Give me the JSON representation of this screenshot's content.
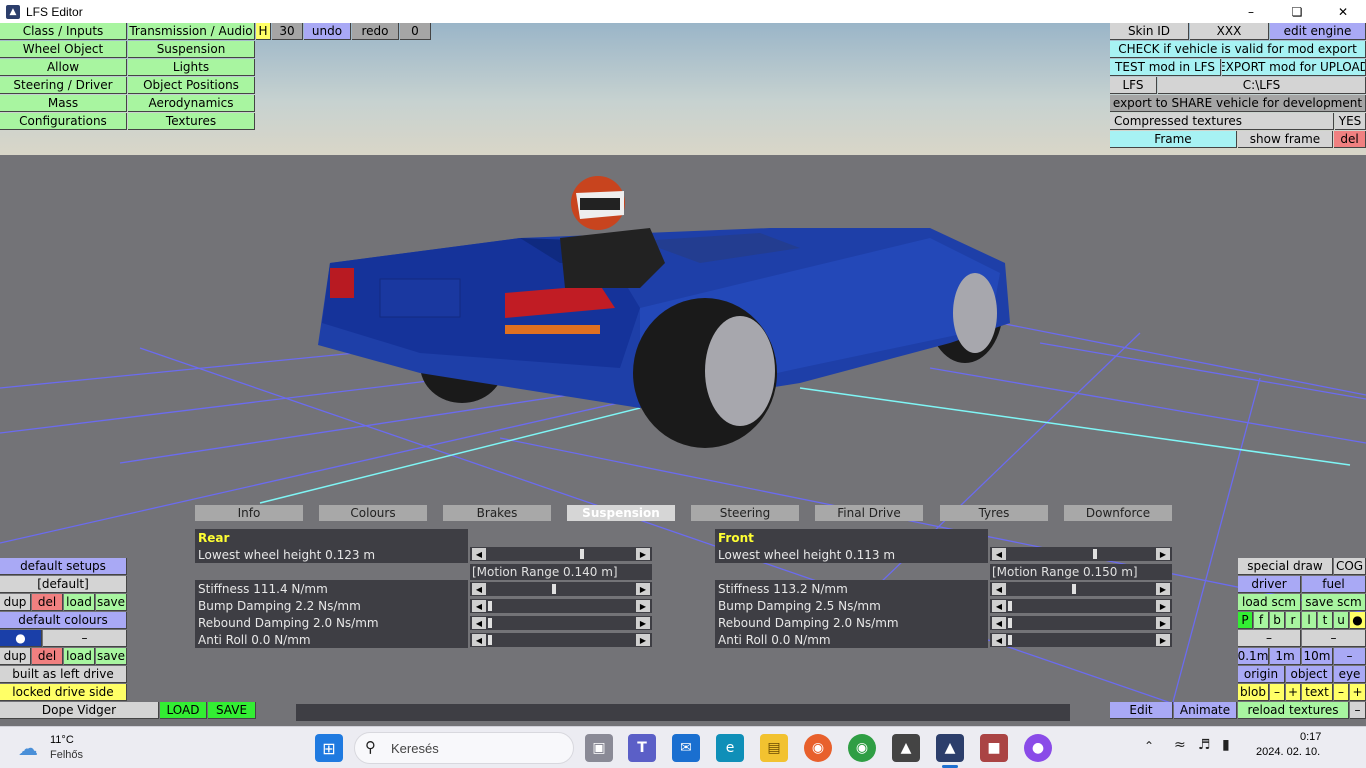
{
  "window": {
    "title": "LFS Editor",
    "minimize": "–",
    "maximize": "❏",
    "close": "✕"
  },
  "left_menu": {
    "class_inputs": "Class / Inputs",
    "transmission_audio": "Transmission / Audio",
    "wheel_object": "Wheel Object",
    "suspension": "Suspension",
    "allow": "Allow",
    "lights": "Lights",
    "steering_driver": "Steering / Driver",
    "object_positions": "Object Positions",
    "mass": "Mass",
    "aerodynamics": "Aerodynamics",
    "configurations": "Configurations",
    "textures": "Textures"
  },
  "toolbar": {
    "h": "H",
    "value_30": "30",
    "undo": "undo",
    "redo": "redo",
    "zero": "0"
  },
  "right_top": {
    "skin_id": "Skin ID",
    "skin_value": "XXX",
    "edit_engine": "edit engine",
    "check_valid": "CHECK if vehicle is valid for mod export",
    "test_mod": "TEST mod in LFS",
    "export_mod": "EXPORT mod for UPLOAD",
    "lfs": "LFS",
    "lfs_path": "C:\\LFS",
    "export_share": "export to SHARE vehicle for development",
    "compressed_textures": "Compressed textures",
    "compressed_value": "YES",
    "frame": "Frame",
    "show_frame": "show frame",
    "del": "del"
  },
  "tabs": [
    "Info",
    "Colours",
    "Brakes",
    "Suspension",
    "Steering",
    "Final Drive",
    "Tyres",
    "Downforce"
  ],
  "active_tab": "Suspension",
  "rear": {
    "header": "Rear",
    "lowest_wheel_height": "Lowest wheel height 0.123 m",
    "motion_range": "[Motion Range 0.140 m]",
    "stiffness": "Stiffness 111.4 N/mm",
    "bump_damping": "Bump Damping 2.2 Ns/mm",
    "rebound_damping": "Rebound Damping 2.0 Ns/mm",
    "anti_roll": "Anti Roll 0.0 N/mm"
  },
  "front": {
    "header": "Front",
    "lowest_wheel_height": "Lowest wheel height 0.113 m",
    "motion_range": "[Motion Range 0.150 m]",
    "stiffness": "Stiffness 113.2 N/mm",
    "bump_damping": "Bump Damping 2.5 Ns/mm",
    "rebound_damping": "Rebound Damping 2.0 Ns/mm",
    "anti_roll": "Anti Roll 0.0 N/mm"
  },
  "slider_levels": {
    "rear": [
      0.65,
      0.45,
      0.0,
      0.0,
      0.0
    ],
    "front": [
      0.6,
      0.45,
      0.0,
      0.0,
      0.0
    ]
  },
  "left_bottom": {
    "default_setups": "default setups",
    "default_value": "[default]",
    "dup": "dup",
    "del": "del",
    "load": "load",
    "save": "save",
    "default_colours": "default colours",
    "dot": "●",
    "dash": "–",
    "built_left": "built as left drive",
    "locked_drive": "locked drive side",
    "car_name": "Dope Vidger",
    "load_big": "LOAD",
    "save_big": "SAVE"
  },
  "right_bottom": {
    "special_draw": "special draw",
    "cog": "COG",
    "driver": "driver",
    "fuel": "fuel",
    "load_scm": "load scm",
    "save_scm": "save scm",
    "letters": [
      "P",
      "f",
      "b",
      "r",
      "l",
      "t",
      "u",
      "●"
    ],
    "dash": "–",
    "d01": "0.1m",
    "d1": "1m",
    "d10": "10m",
    "origin": "origin",
    "object": "object",
    "eye": "eye",
    "blob": "blob",
    "minus": "–",
    "plus": "+",
    "text": "text",
    "edit": "Edit",
    "animate": "Animate",
    "reload_textures": "reload textures"
  },
  "taskbar": {
    "temp": "11°C",
    "weather": "Felhős",
    "search": "Keresés",
    "time": "0:17",
    "date": "2024. 02. 10."
  }
}
